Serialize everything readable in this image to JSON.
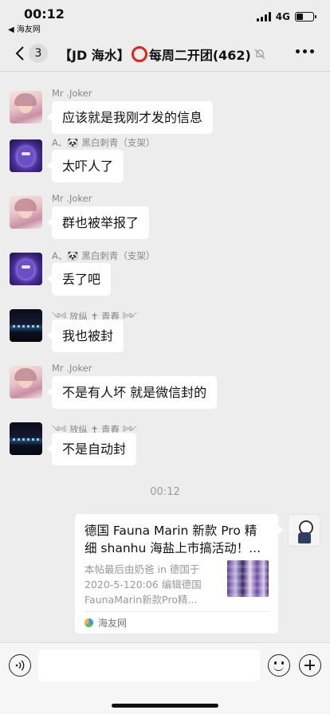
{
  "status_bar": {
    "time": "00:12",
    "back_app": "◀ 海友网",
    "network": "4G",
    "battery_level": 0.4
  },
  "nav": {
    "unread_count": "3",
    "title_prefix": "【JD 海水】",
    "title_suffix": "每周二开团(462)",
    "mute_icon": "mute-bell-icon",
    "more_icon": "more-dots-icon"
  },
  "messages": [
    {
      "sender": "Mr .Joker",
      "text": "应该就是我刚才发的信息",
      "avatar": "joker"
    },
    {
      "sender": "A、🐼 黑白刺青（支架）",
      "text": "太吓人了",
      "avatar": "panda"
    },
    {
      "sender": "Mr .Joker",
      "text": "群也被举报了",
      "avatar": "joker"
    },
    {
      "sender": "A、🐼 黑白刺青（支架）",
      "text": "丢了吧",
      "avatar": "panda"
    },
    {
      "sender": "༺ 放纵 ✝ 青春 ༻",
      "text": "我也被封",
      "avatar": "night"
    },
    {
      "sender": "Mr .Joker",
      "text": "不是有人坏 就是微信封的",
      "avatar": "joker"
    },
    {
      "sender": "༺ 放纵 ✝ 青春 ༻",
      "text": "不是自动封",
      "avatar": "night"
    }
  ],
  "timestamp": "00:12",
  "link_card": {
    "title": "德国 Fauna Marin 新款 Pro 精细 shanhu 海盐上市搞活动！...",
    "description": "本帖最后由奶爸 in 德国于 2020-5-120:06 编辑德国 FaunaMarin新款Pro精...",
    "source": "海友网"
  },
  "input_bar": {
    "input_value": "",
    "voice_icon": "voice-icon",
    "emoji_icon": "emoji-icon",
    "plus_icon": "plus-icon"
  },
  "colors": {
    "background": "#ededed",
    "bubble": "#ffffff",
    "mute_red": "#e0241b"
  }
}
